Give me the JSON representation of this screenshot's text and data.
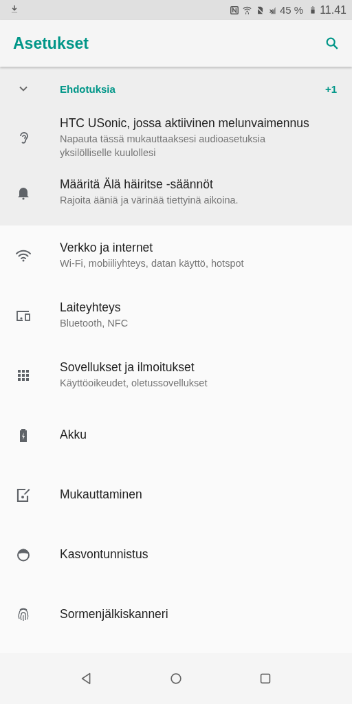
{
  "status_bar": {
    "battery_text": "45 %",
    "time": "11.41"
  },
  "app_bar": {
    "title": "Asetukset"
  },
  "suggestions": {
    "title": "Ehdotuksia",
    "count": "+1",
    "expanded": true,
    "items": [
      {
        "kind": "ear",
        "title": "HTC USonic, jossa aktiivinen melunvaimennus",
        "subtitle": "Napauta tässä mukauttaaksesi audioasetuksia yksilölliselle kuulollesi"
      },
      {
        "kind": "bell",
        "title": "Määritä Älä häiritse -säännöt",
        "subtitle": "Rajoita ääniä ja värinää tiettyinä aikoina."
      }
    ]
  },
  "settings": [
    {
      "kind": "wifi",
      "title": "Verkko ja internet",
      "subtitle": "Wi-Fi, mobiiliyhteys, datan käyttö, hotspot"
    },
    {
      "kind": "devices",
      "title": "Laiteyhteys",
      "subtitle": "Bluetooth, NFC"
    },
    {
      "kind": "apps",
      "title": "Sovellukset ja ilmoitukset",
      "subtitle": "Käyttöoikeudet, oletussovellukset"
    },
    {
      "kind": "battery",
      "title": "Akku"
    },
    {
      "kind": "edit",
      "title": "Mukauttaminen"
    },
    {
      "kind": "face",
      "title": "Kasvontunnistus"
    },
    {
      "kind": "fingerprint",
      "title": "Sormenjälkiskanneri"
    }
  ]
}
